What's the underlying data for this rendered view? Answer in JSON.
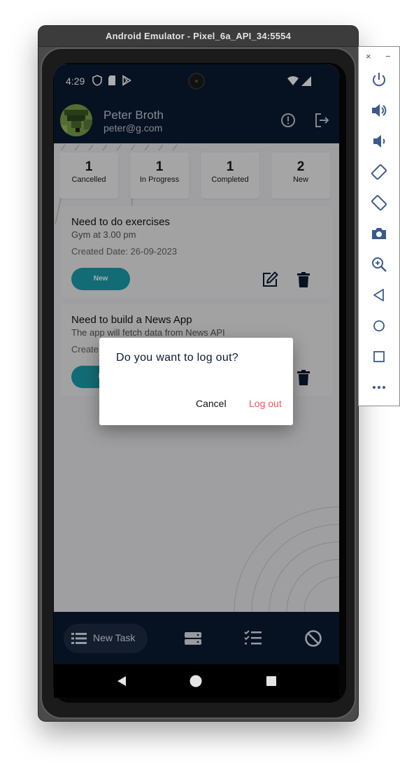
{
  "window": {
    "title": "Android Emulator - Pixel_6a_API_34:5554"
  },
  "status_bar": {
    "time": "4:29"
  },
  "app_bar": {
    "user_name": "Peter Broth",
    "user_email": "peter@g.com"
  },
  "stats": [
    {
      "count": "1",
      "label": "Cancelled"
    },
    {
      "count": "1",
      "label": "In Progress"
    },
    {
      "count": "1",
      "label": "Completed"
    },
    {
      "count": "2",
      "label": "New"
    }
  ],
  "tasks": [
    {
      "title": "Need to do exercises",
      "description": "Gym at 3.00 pm",
      "created": "Created Date: 26-09-2023",
      "status": "New"
    },
    {
      "title": "Need to build a News App",
      "description": "The app will fetch data from News API",
      "created": "Create",
      "status": "N"
    }
  ],
  "bottom_nav": {
    "active_label": "New Task"
  },
  "dialog": {
    "title": "Do you want to log out?",
    "cancel_label": "Cancel",
    "confirm_label": "Log out"
  },
  "colors": {
    "navy": "#0a1a33",
    "teal": "#1ba0ae",
    "danger": "#f0565a"
  },
  "side_panel": {
    "close_label": "×",
    "minimize_label": "−",
    "buttons": [
      "power-icon",
      "volume-up-icon",
      "volume-down-icon",
      "rotate-left-icon",
      "rotate-right-icon",
      "camera-icon",
      "zoom-icon",
      "back-icon",
      "home-icon",
      "overview-icon",
      "more-icon"
    ]
  }
}
